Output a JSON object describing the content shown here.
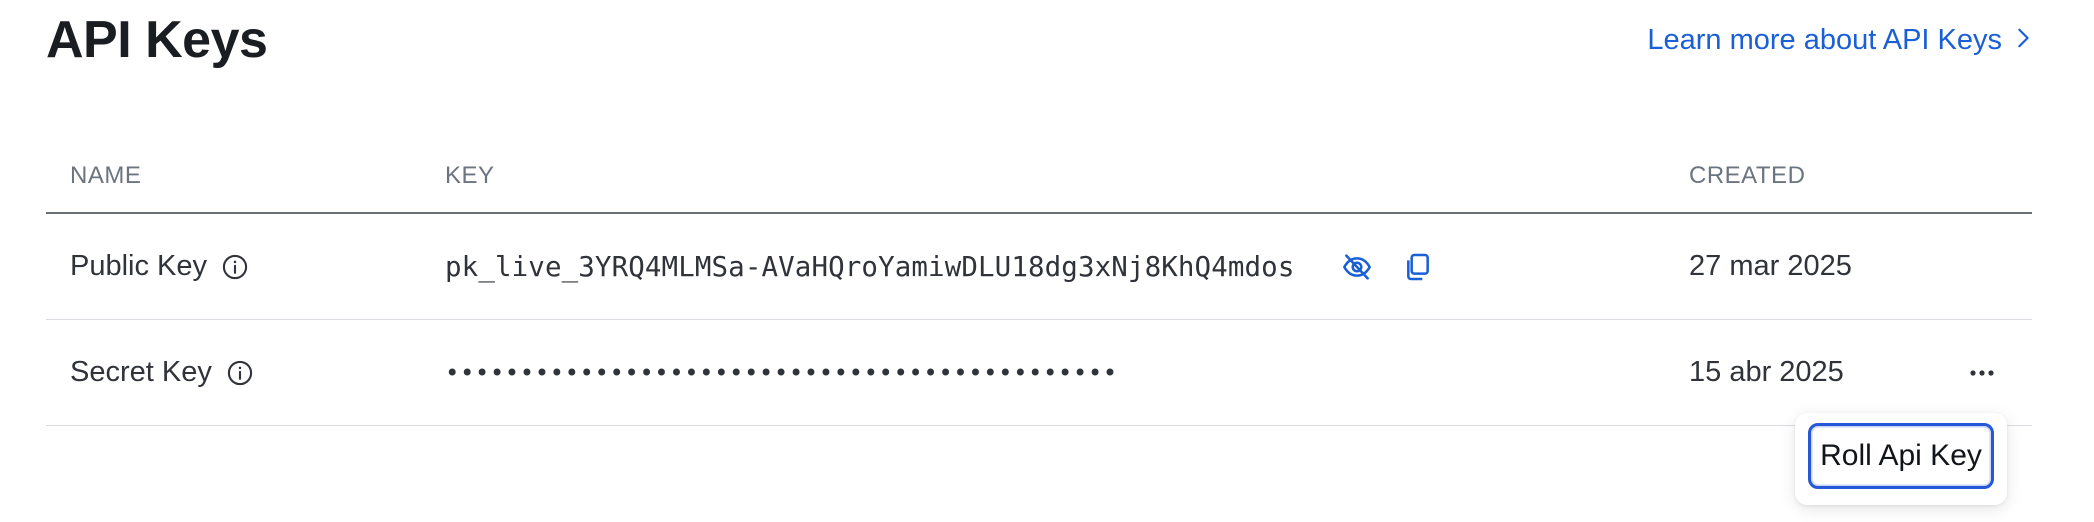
{
  "header": {
    "title": "API Keys",
    "learn_more": "Learn more about API Keys"
  },
  "table": {
    "columns": {
      "name": "NAME",
      "key": "KEY",
      "created": "CREATED"
    },
    "rows": [
      {
        "name": "Public Key",
        "key": "pk_live_3YRQ4MLMSa-AVaHQroYamiwDLU18dg3xNj8KhQ4mdos",
        "created": "27 mar 2025"
      },
      {
        "name": "Secret Key",
        "key": "•••••••••••••••••••••••••••••••••••••••••••••",
        "created": "15 abr 2025"
      }
    ]
  },
  "menu": {
    "roll_label": "Roll Api Key"
  },
  "icons": {
    "info": "info-icon",
    "visibility_toggle": "eye-slash-icon",
    "copy": "copy-icon",
    "more": "ellipsis-icon",
    "chevron": "chevron-right-icon"
  },
  "colors": {
    "link": "#1a5fd6",
    "button_border": "#2557d6",
    "header_text": "#6b7480"
  }
}
